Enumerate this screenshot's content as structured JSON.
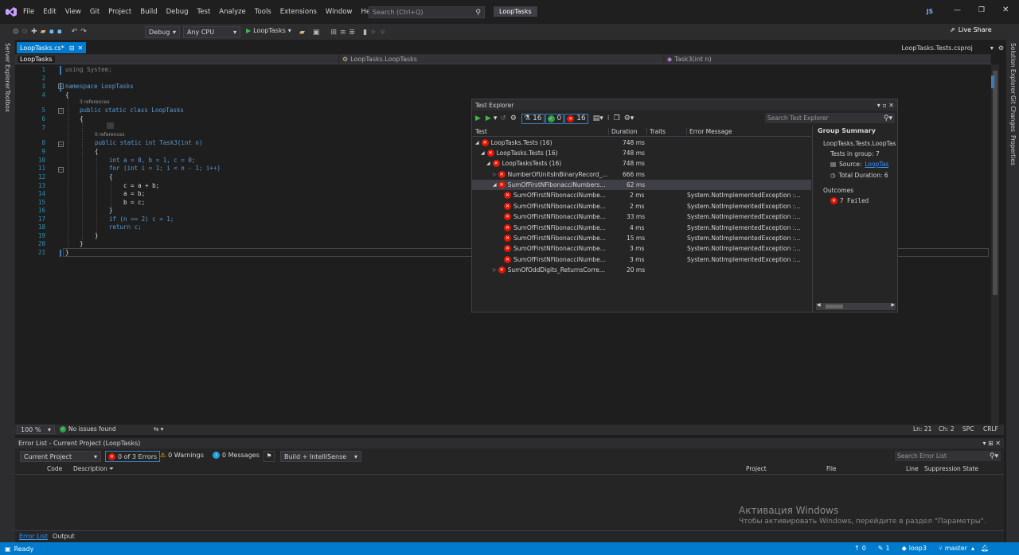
{
  "menu": [
    "File",
    "Edit",
    "View",
    "Git",
    "Project",
    "Build",
    "Debug",
    "Test",
    "Analyze",
    "Tools",
    "Extensions",
    "Window",
    "Help"
  ],
  "search": {
    "placeholder": "Search (Ctrl+Q)"
  },
  "app_title": "LoopTasks",
  "user_initials": "JS",
  "live_share": "Live Share",
  "toolbar": {
    "config": "Debug",
    "platform": "Any CPU",
    "run_target": "LoopTasks"
  },
  "left_rail": [
    "Server Explorer",
    "Toolbox"
  ],
  "right_rail": [
    "Solution Explorer",
    "Git Changes",
    "Properties"
  ],
  "doc_tab": "LoopTasks.cs*",
  "right_tab": "LoopTasks.Tests.csproj",
  "nav": {
    "project": "LoopTasks",
    "class": "LoopTasks.LoopTasks",
    "member": "Task3(int n)"
  },
  "code_lines": [
    {
      "n": "1",
      "t": "using System;"
    },
    {
      "n": "2",
      "t": ""
    },
    {
      "n": "3",
      "t": "namespace LoopTasks"
    },
    {
      "n": "4",
      "t": "{"
    },
    {
      "n": "5",
      "t": "public static class LoopTasks",
      "ref": "3 references"
    },
    {
      "n": "6",
      "t": "{"
    },
    {
      "n": "7",
      "t": ""
    },
    {
      "n": "8",
      "t": "public static int Task3(int n)",
      "ref": "0 references"
    },
    {
      "n": "9",
      "t": "{"
    },
    {
      "n": "10",
      "t": "int a = 0, b = 1, c = 0;"
    },
    {
      "n": "11",
      "t": "for (int i = 1; i < n - 1; i++)"
    },
    {
      "n": "12",
      "t": "{"
    },
    {
      "n": "13",
      "t": "c = a + b;"
    },
    {
      "n": "14",
      "t": "a = b;"
    },
    {
      "n": "15",
      "t": "b = c;"
    },
    {
      "n": "16",
      "t": "}"
    },
    {
      "n": "17",
      "t": "if (n == 2) c = 1;"
    },
    {
      "n": "18",
      "t": "return c;"
    },
    {
      "n": "19",
      "t": "}"
    },
    {
      "n": "20",
      "t": "}"
    },
    {
      "n": "21",
      "t": "}"
    }
  ],
  "editor_status": {
    "zoom": "100 %",
    "issues": "No issues found",
    "ln": "Ln: 21",
    "ch": "Ch: 2",
    "spc": "SPC",
    "crlf": "CRLF"
  },
  "test_explorer": {
    "title": "Test Explorer",
    "counts": {
      "total": "16",
      "passed": "0",
      "failed": "16"
    },
    "search_placeholder": "Search Test Explorer",
    "columns": [
      "Test",
      "Duration",
      "Traits",
      "Error Message"
    ],
    "rows": [
      {
        "name": "LoopTasks.Tests (16)",
        "dur": "748 ms",
        "err": ""
      },
      {
        "name": "LoopTasks.Tests (16)",
        "dur": "748 ms",
        "err": ""
      },
      {
        "name": "LoopTasksTests (16)",
        "dur": "748 ms",
        "err": ""
      },
      {
        "name": "NumberOfUnitsInBinaryRecord_...",
        "dur": "666 ms",
        "err": ""
      },
      {
        "name": "SumOfFirstNFibonacciNumbers...",
        "dur": "62 ms",
        "err": ""
      },
      {
        "name": "SumOfFirstNFibonacciNumbe...",
        "dur": "2 ms",
        "err": "System.NotImplementedException :..."
      },
      {
        "name": "SumOfFirstNFibonacciNumbe...",
        "dur": "2 ms",
        "err": "System.NotImplementedException :..."
      },
      {
        "name": "SumOfFirstNFibonacciNumbe...",
        "dur": "33 ms",
        "err": "System.NotImplementedException :..."
      },
      {
        "name": "SumOfFirstNFibonacciNumbe...",
        "dur": "4 ms",
        "err": "System.NotImplementedException :..."
      },
      {
        "name": "SumOfFirstNFibonacciNumbe...",
        "dur": "15 ms",
        "err": "System.NotImplementedException :..."
      },
      {
        "name": "SumOfFirstNFibonacciNumbe...",
        "dur": "3 ms",
        "err": "System.NotImplementedException :..."
      },
      {
        "name": "SumOfFirstNFibonacciNumbe...",
        "dur": "3 ms",
        "err": "System.NotImplementedException :..."
      },
      {
        "name": "SumOfOddDigits_ReturnsCorre...",
        "dur": "20 ms",
        "err": ""
      }
    ],
    "summary": {
      "heading": "Group Summary",
      "group": "LoopTasks.Tests.LoopTas",
      "tests_in_group": "Tests in group:  7",
      "source_label": "Source:",
      "source_link": "LoopTas",
      "total_duration": "Total Duration:  6",
      "outcomes": "Outcomes",
      "failed": "7 Failed"
    }
  },
  "error_list": {
    "title": "Error List - Current Project (LoopTasks)",
    "scope": "Current Project",
    "errors": "0 of 3 Errors",
    "warnings": "0 Warnings",
    "messages": "0 Messages",
    "build": "Build + IntelliSense",
    "search_placeholder": "Search Error List",
    "columns": [
      "Code",
      "Description",
      "Project",
      "File",
      "Line",
      "Suppression State"
    ],
    "tabs": [
      "Error List",
      "Output"
    ]
  },
  "watermark": {
    "line1": "Активация Windows",
    "line2": "Чтобы активировать Windows, перейдите в раздел \"Параметры\"."
  },
  "status": {
    "ready": "Ready",
    "up": "0",
    "pencil": "1",
    "repo": "loop3",
    "branch": "master"
  },
  "colors": {
    "accent": "#007acc",
    "fail": "#e51400",
    "pass": "#2ea043"
  }
}
